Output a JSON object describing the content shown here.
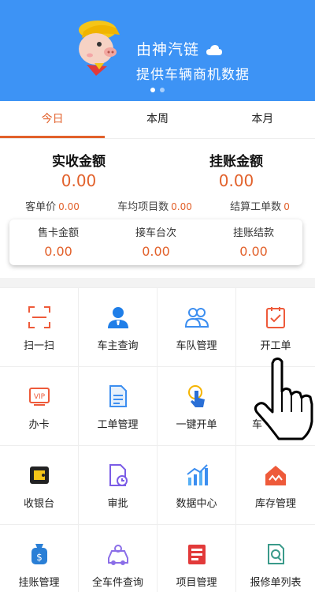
{
  "banner": {
    "line1": "由神汽链",
    "line2": "提供车辆商机数据",
    "slides": 2,
    "active_slide": 0
  },
  "tabs": [
    {
      "label": "今日",
      "active": true
    },
    {
      "label": "本周",
      "active": false
    },
    {
      "label": "本月",
      "active": false
    }
  ],
  "summary": {
    "received": {
      "label": "实收金额",
      "value": "0.00"
    },
    "credit": {
      "label": "挂账金额",
      "value": "0.00"
    },
    "per_order": {
      "label": "客单价",
      "value": "0.00"
    },
    "avg_items": {
      "label": "车均项目数",
      "value": "0.00"
    },
    "settled": {
      "label": "结算工单数",
      "value": "0"
    }
  },
  "card": {
    "card_sales": {
      "label": "售卡金额",
      "value": "0.00"
    },
    "pickups": {
      "label": "接车台次",
      "value": "0.00"
    },
    "credit_settled": {
      "label": "挂账结款",
      "value": "0.00"
    }
  },
  "menu": [
    {
      "label": "扫一扫",
      "icon": "scan-icon"
    },
    {
      "label": "车主查询",
      "icon": "owner-query-icon"
    },
    {
      "label": "车队管理",
      "icon": "fleet-icon"
    },
    {
      "label": "开工单",
      "icon": "work-order-icon"
    },
    {
      "label": "办卡",
      "icon": "vip-card-icon"
    },
    {
      "label": "工单管理",
      "icon": "order-manage-icon"
    },
    {
      "label": "一键开单",
      "icon": "one-click-icon"
    },
    {
      "label": "车",
      "icon": "car-icon"
    },
    {
      "label": "收银台",
      "icon": "cashier-icon"
    },
    {
      "label": "审批",
      "icon": "approval-icon"
    },
    {
      "label": "数据中心",
      "icon": "data-center-icon"
    },
    {
      "label": "库存管理",
      "icon": "inventory-icon"
    },
    {
      "label": "挂账管理",
      "icon": "credit-manage-icon"
    },
    {
      "label": "全车件查询",
      "icon": "parts-query-icon"
    },
    {
      "label": "项目管理",
      "icon": "project-icon"
    },
    {
      "label": "报修单列表",
      "icon": "repair-list-icon"
    }
  ],
  "colors": {
    "brand_blue": "#3d93f5",
    "accent_orange": "#e2612b"
  }
}
